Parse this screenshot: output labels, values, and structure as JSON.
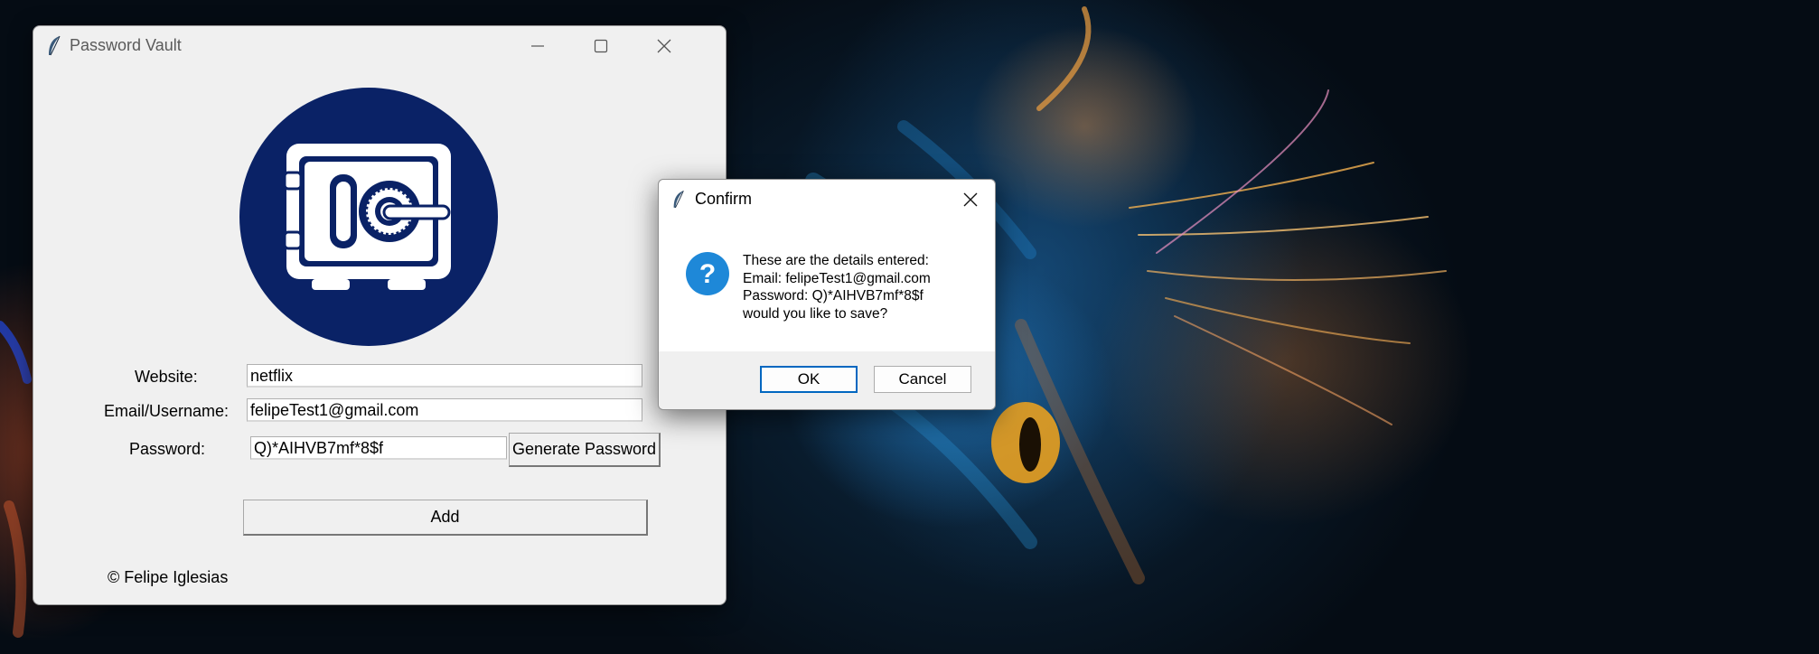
{
  "window": {
    "title": "Password Vault",
    "icon": "feather-icon",
    "controls": [
      "minimize-icon",
      "maximize-icon",
      "close-icon"
    ]
  },
  "logo": {
    "icon": "safe-icon",
    "color": "#0a2266"
  },
  "form": {
    "website_label": "Website:",
    "website_value": "netflix",
    "email_label": "Email/Username:",
    "email_value": "felipeTest1@gmail.com",
    "password_label": "Password:",
    "password_value": "Q)*AIHVB7mf*8$f",
    "generate_button": "Generate Password",
    "add_button": "Add"
  },
  "footer": {
    "copyright": "© Felipe Iglesias"
  },
  "dialog": {
    "title": "Confirm",
    "icon": "question-icon",
    "message_line1": "These are the details entered:",
    "message_line2": "Email: felipeTest1@gmail.com",
    "message_line3": "Password: Q)*AIHVB7mf*8$f",
    "message_line4": "would you like to save?",
    "ok_button": "OK",
    "cancel_button": "Cancel"
  }
}
